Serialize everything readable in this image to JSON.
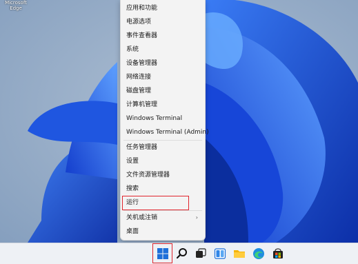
{
  "desktop": {
    "icons": [
      {
        "label": "Microsoft Edge",
        "icon": "edge-icon"
      }
    ]
  },
  "context_menu": {
    "items": [
      {
        "label": "应用和功能"
      },
      {
        "label": "电源选项"
      },
      {
        "label": "事件查看器"
      },
      {
        "label": "系统"
      },
      {
        "label": "设备管理器"
      },
      {
        "label": "网络连接"
      },
      {
        "label": "磁盘管理"
      },
      {
        "label": "计算机管理"
      },
      {
        "label": "Windows Terminal"
      },
      {
        "label": "Windows Terminal (Admin)"
      },
      {
        "label": "任务管理器"
      },
      {
        "label": "设置"
      },
      {
        "label": "文件资源管理器"
      },
      {
        "label": "搜索"
      },
      {
        "label": "运行",
        "highlighted": true
      },
      {
        "label": "关机或注销",
        "has_submenu": true
      },
      {
        "label": "桌面"
      }
    ]
  },
  "taskbar": {
    "icons": [
      "start-icon",
      "search-icon",
      "task-view-icon",
      "widgets-icon",
      "file-explorer-icon",
      "edge-icon",
      "store-icon"
    ]
  },
  "colors": {
    "highlight": "#e0232b",
    "menu_bg": "#f3f3f3",
    "taskbar_bg": "#eef1f5",
    "wallpaper_blue": "#1e4fd6"
  }
}
